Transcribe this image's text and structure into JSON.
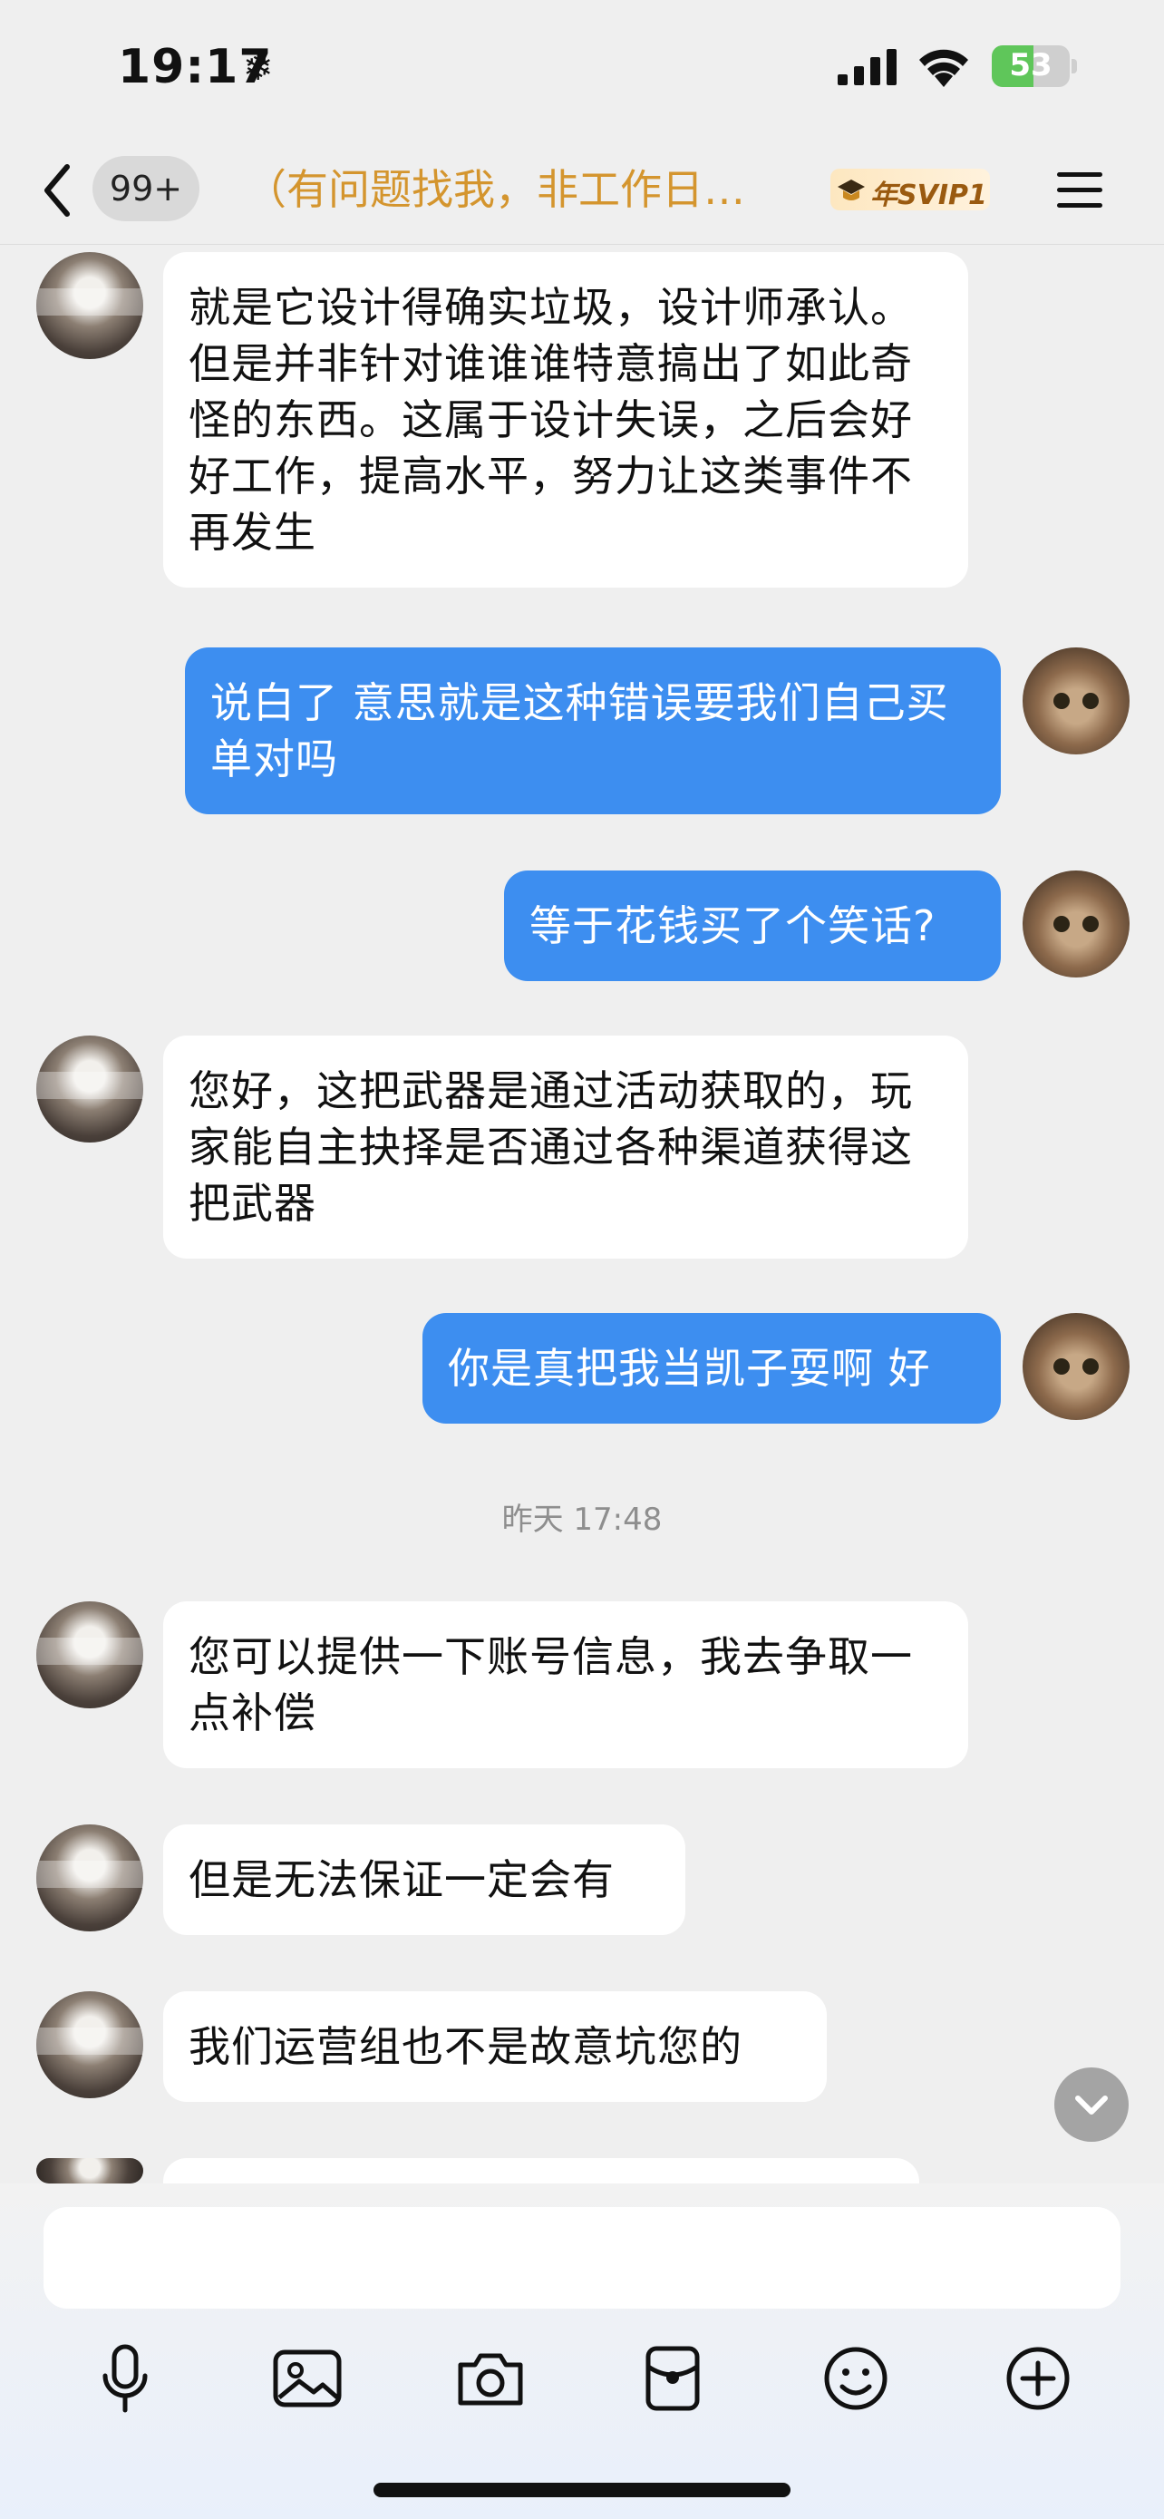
{
  "status_bar": {
    "time": "19:17",
    "weather_glyph": "❄",
    "battery": "53",
    "battery_level": 0.53
  },
  "header": {
    "unread_badge": "99+",
    "title": "（有问题找我，非工作日…",
    "vip_label": "年SVIP1"
  },
  "messages": [
    {
      "side": "in",
      "text": "就是它设计得确实垃圾，设计师承认。但是并非针对谁谁谁特意搞出了如此奇怪的东西。这属于设计失误，之后会好好工作，提高水平，努力让这类事件不再发生"
    },
    {
      "side": "out",
      "text": "说白了 意思就是这种错误要我们自己买单对吗"
    },
    {
      "side": "out",
      "text": "等于花钱买了个笑话?"
    },
    {
      "side": "in",
      "text": "您好，这把武器是通过活动获取的，玩家能自主抉择是否通过各种渠道获得这把武器"
    },
    {
      "side": "out",
      "text": "你是真把我当凯子耍啊 好"
    },
    {
      "side": "in",
      "text": "您可以提供一下账号信息，我去争取一点补偿"
    },
    {
      "side": "in",
      "text": "但是无法保证一定会有"
    },
    {
      "side": "in",
      "text": "我们运营组也不是故意坑您的"
    }
  ],
  "timestamp": "昨天 17:48",
  "composer": {
    "placeholder": "",
    "tools": [
      "microphone-icon",
      "image-icon",
      "camera-icon",
      "red-packet-icon",
      "emoji-icon",
      "plus-icon"
    ]
  },
  "colors": {
    "accent_blue": "#3d8ef0",
    "title_gold": "#d4952e",
    "background": "#efefef"
  }
}
